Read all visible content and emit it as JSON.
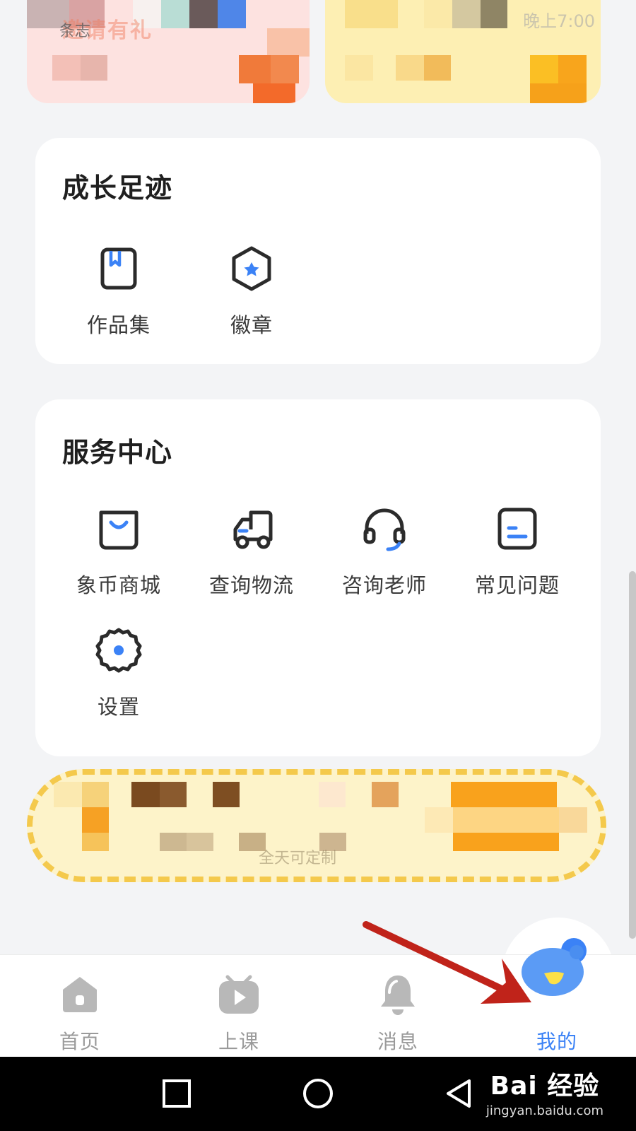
{
  "top_banners": {
    "left_title": "邀请有礼",
    "left_label": "条志",
    "right_text": "晚上7:00"
  },
  "growth": {
    "title": "成长足迹",
    "items": [
      {
        "label": "作品集",
        "icon": "portfolio-icon"
      },
      {
        "label": "徽章",
        "icon": "badge-icon"
      }
    ]
  },
  "service": {
    "title": "服务中心",
    "items": [
      {
        "label": "象币商城",
        "icon": "shopping-bag-icon"
      },
      {
        "label": "查询物流",
        "icon": "delivery-truck-icon"
      },
      {
        "label": "咨询老师",
        "icon": "headset-icon"
      },
      {
        "label": "常见问题",
        "icon": "faq-document-icon"
      },
      {
        "label": "设置",
        "icon": "settings-gear-icon"
      }
    ]
  },
  "promo": {
    "text": "全天可定制"
  },
  "tabbar": {
    "tabs": [
      {
        "label": "首页",
        "icon": "home-icon",
        "active": false
      },
      {
        "label": "上课",
        "icon": "class-play-icon",
        "active": false
      },
      {
        "label": "消息",
        "icon": "bell-icon",
        "active": false
      },
      {
        "label": "我的",
        "icon": "mascot-icon",
        "active": true
      }
    ]
  },
  "navbar": {
    "buttons": [
      "recent-apps-icon",
      "home-circle-icon",
      "back-triangle-icon"
    ]
  },
  "watermark": {
    "main": "Bai 经验",
    "sub": "jingyan.baidu.com"
  },
  "colors": {
    "accent": "#3b82f6",
    "icon_dark": "#2b2b2b",
    "tab_inactive": "#9a9a9a",
    "arrow": "#c0231a",
    "background": "#f3f4f6"
  }
}
